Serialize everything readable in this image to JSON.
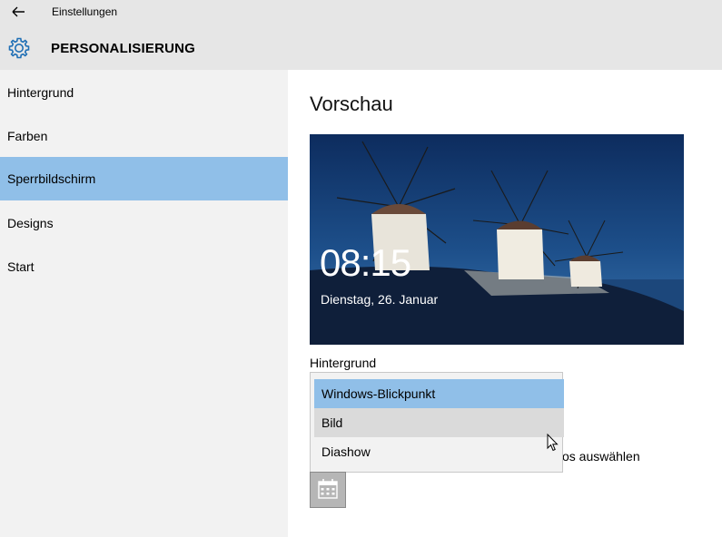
{
  "window": {
    "title": "Einstellungen",
    "back_icon": "arrow-left-icon"
  },
  "header": {
    "section_title": "PERSONALISIERUNG",
    "icon": "gear-icon",
    "accent": "#1f6fb5"
  },
  "sidebar": {
    "items": [
      {
        "label": "Hintergrund",
        "active": false
      },
      {
        "label": "Farben",
        "active": false
      },
      {
        "label": "Sperrbildschirm",
        "active": true
      },
      {
        "label": "Designs",
        "active": false
      },
      {
        "label": "Start",
        "active": false
      }
    ],
    "active_color": "#90bfe8"
  },
  "main": {
    "preview_heading": "Vorschau",
    "preview": {
      "time": "08:15",
      "date": "Dienstag, 26. Januar"
    },
    "background_label": "Hintergrund",
    "dropdown": {
      "options": [
        {
          "label": "Windows-Blickpunkt",
          "state": "selected"
        },
        {
          "label": "Bild",
          "state": "hover"
        },
        {
          "label": "Diashow",
          "state": "normal"
        }
      ]
    },
    "partially_hidden_text": "os auswählen",
    "calendar_button_icon": "calendar-icon"
  }
}
